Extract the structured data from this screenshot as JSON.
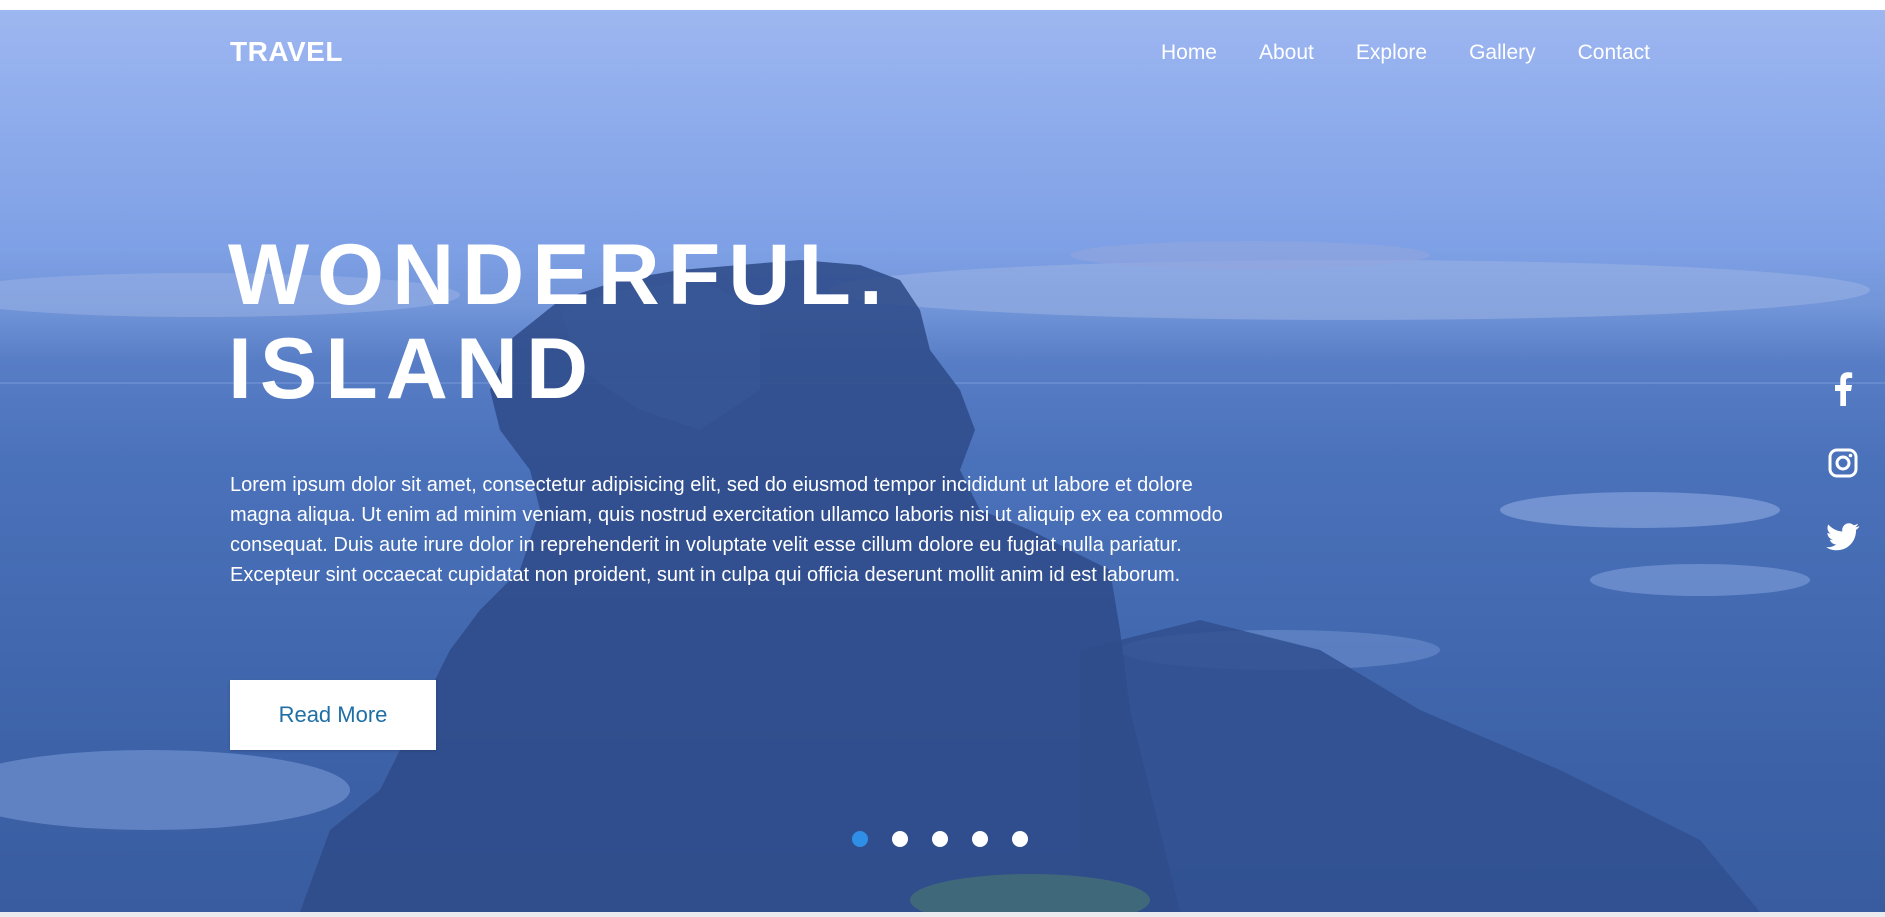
{
  "brand": {
    "logo": "TRAVEL"
  },
  "nav": {
    "items": [
      {
        "label": "Home"
      },
      {
        "label": "About"
      },
      {
        "label": "Explore"
      },
      {
        "label": "Gallery"
      },
      {
        "label": "Contact"
      }
    ]
  },
  "hero": {
    "title_line1": "WONDERFUL.",
    "title_line2": "ISLAND",
    "description": "Lorem ipsum dolor sit amet, consectetur adipisicing elit, sed do eiusmod tempor incididunt ut labore et dolore magna aliqua. Ut enim ad minim veniam, quis nostrud exercitation ullamco laboris nisi ut aliquip ex ea commodo consequat. Duis aute irure dolor in reprehenderit in voluptate velit esse cillum dolore eu fugiat nulla pariatur. Excepteur sint occaecat cupidatat non proident, sunt in culpa qui officia deserunt mollit anim id est laborum.",
    "button_label": "Read More"
  },
  "carousel": {
    "slide_count": 5,
    "active_index": 0
  },
  "social": {
    "icons": [
      "facebook-icon",
      "instagram-icon",
      "twitter-icon"
    ]
  },
  "colors": {
    "accent": "#2f8fe6",
    "button_text": "#1f6fa6",
    "text": "#ffffff"
  }
}
